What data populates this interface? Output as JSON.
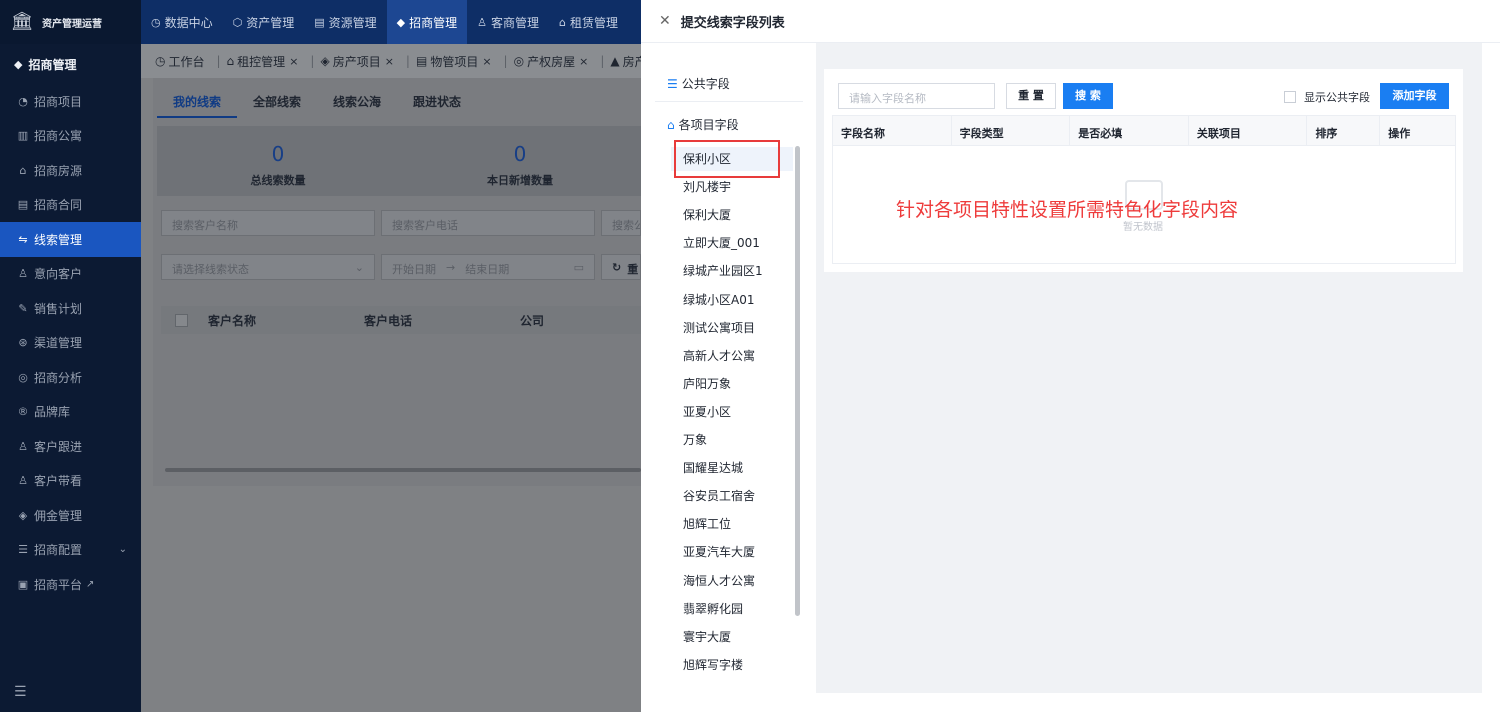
{
  "app": {
    "title": "资产管理运营"
  },
  "sidebar": {
    "section": "招商管理",
    "items": [
      {
        "label": "招商项目",
        "icon": "project-icon"
      },
      {
        "label": "招商公寓",
        "icon": "building-icon"
      },
      {
        "label": "招商房源",
        "icon": "home-icon"
      },
      {
        "label": "招商合同",
        "icon": "contract-icon"
      },
      {
        "label": "线索管理",
        "icon": "lead-icon",
        "active": true
      },
      {
        "label": "意向客户",
        "icon": "user-icon"
      },
      {
        "label": "销售计划",
        "icon": "plan-icon"
      },
      {
        "label": "渠道管理",
        "icon": "channel-icon"
      },
      {
        "label": "招商分析",
        "icon": "analysis-icon"
      },
      {
        "label": "品牌库",
        "icon": "brand-icon"
      },
      {
        "label": "客户跟进",
        "icon": "follow-icon"
      },
      {
        "label": "客户带看",
        "icon": "visit-icon"
      },
      {
        "label": "佣金管理",
        "icon": "commission-icon"
      },
      {
        "label": "招商配置",
        "icon": "config-icon",
        "chevron": true
      },
      {
        "label": "招商平台",
        "icon": "platform-icon",
        "external": true
      }
    ]
  },
  "topnav": {
    "items": [
      {
        "label": "数据中心",
        "icon": "dashboard-icon"
      },
      {
        "label": "资产管理",
        "icon": "asset-icon"
      },
      {
        "label": "资源管理",
        "icon": "resource-icon"
      },
      {
        "label": "招商管理",
        "icon": "tag-icon",
        "active": true
      },
      {
        "label": "客商管理",
        "icon": "merchant-icon"
      },
      {
        "label": "租赁管理",
        "icon": "lease-icon"
      }
    ]
  },
  "tabs": [
    "工作台",
    "租控管理",
    "房产项目",
    "物管项目",
    "产权房屋",
    "房产资料"
  ],
  "main": {
    "subtabs": [
      "我的线索",
      "全部线索",
      "线索公海",
      "跟进状态"
    ],
    "stats": [
      {
        "value": "0",
        "label": "总线索数量"
      },
      {
        "value": "0",
        "label": "本日新增数量"
      }
    ],
    "filters": {
      "name_placeholder": "搜索客户名称",
      "phone_placeholder": "搜索客户电话",
      "third_placeholder": "搜索公",
      "status_placeholder": "请选择线索状态",
      "start_date": "开始日期",
      "end_date": "结束日期",
      "reset": "重"
    },
    "table_headers": [
      "客户名称",
      "客户电话",
      "公司"
    ]
  },
  "drawer": {
    "title": "提交线索字段列表",
    "public_fields": "公共字段",
    "project_fields": "各项目字段",
    "projects": [
      "保利小区",
      "刘凡楼宇",
      "保利大厦",
      "立即大厦_001",
      "绿城产业园区1",
      "绿城小区A01",
      "测试公寓项目",
      "高新人才公寓",
      "庐阳万象",
      "亚夏小区",
      "万象",
      "国耀星达城",
      "谷安员工宿舍",
      "旭辉工位",
      "亚夏汽车大厦",
      "海恒人才公寓",
      "翡翠孵化园",
      "寰宇大厦",
      "旭辉写字楼"
    ],
    "selected_project": "保利小区",
    "search_placeholder": "请输入字段名称",
    "reset_label": "重 置",
    "search_label": "搜 索",
    "show_public_label": "显示公共字段",
    "add_label": "添加字段",
    "columns": [
      "字段名称",
      "字段类型",
      "是否必填",
      "关联项目",
      "排序",
      "操作"
    ],
    "empty_text": "暂无数据",
    "annotation": "针对各项目特性设置所需特色化字段内容"
  },
  "colors": {
    "primary": "#1a7ef2",
    "highlight": "#e83b3b",
    "sidebar": "#0c1a33",
    "topnav": "#0e2e66"
  }
}
